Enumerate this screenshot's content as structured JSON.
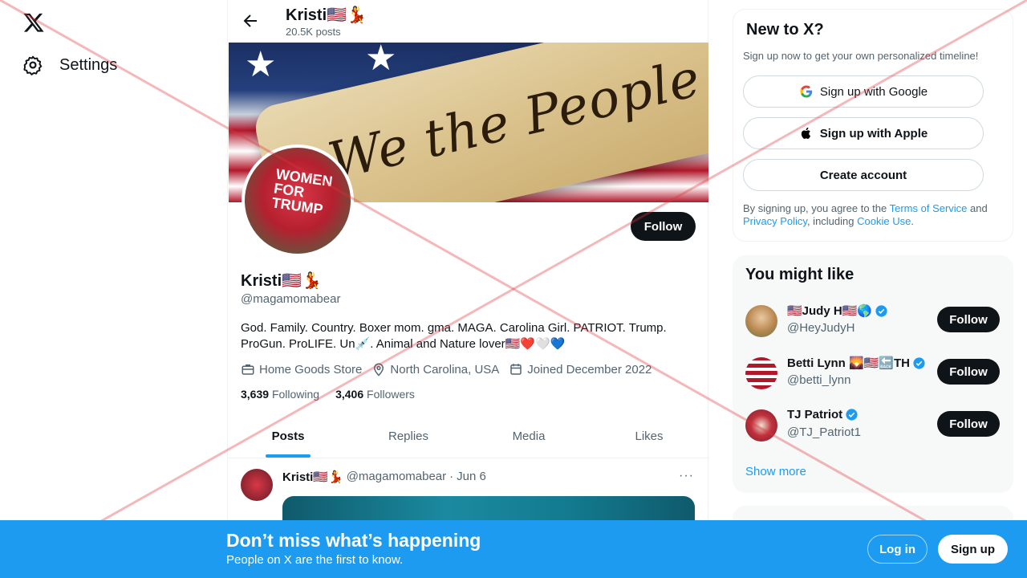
{
  "nav": {
    "logo_icon": "x-logo",
    "settings_label": "Settings"
  },
  "topbar": {
    "name": "Kristi🇺🇸💃",
    "posts_count": "20.5K posts"
  },
  "banner": {
    "script_text": "We the People"
  },
  "avatar": {
    "cap_text": "WOMEN FOR TRUMP"
  },
  "profile": {
    "follow_label": "Follow",
    "name": "Kristi🇺🇸💃",
    "handle": "@magamomabear",
    "bio": "God. Family. Country. Boxer mom. gma. MAGA. Carolina Girl. PATRIOT. Trump. ProGun. ProLIFE. Un💉. Animal and Nature lover🇺🇸❤️🤍💙",
    "work": "Home Goods Store",
    "location": "North Carolina, USA",
    "joined": "Joined December 2022",
    "following_count": "3,639",
    "following_label": "Following",
    "followers_count": "3,406",
    "followers_label": "Followers"
  },
  "tabs": [
    "Posts",
    "Replies",
    "Media",
    "Likes"
  ],
  "post": {
    "name": "Kristi🇺🇸💃",
    "handle": "@magamomabear",
    "sep": "·",
    "date": "Jun 6",
    "more": "···"
  },
  "new_to_x": {
    "title": "New to X?",
    "subtitle": "Sign up now to get your own personalized timeline!",
    "google_label": "Sign up with Google",
    "apple_label": "Sign up with Apple",
    "create_label": "Create account",
    "legal_prefix": "By signing up, you agree to the ",
    "terms": "Terms of Service",
    "and": " and ",
    "privacy": "Privacy Policy",
    "including": ", including ",
    "cookie": "Cookie Use",
    "period": "."
  },
  "you_might_like": {
    "title": "You might like",
    "users": [
      {
        "name": "🇺🇸Judy H🇺🇸🌎",
        "handle": "@HeyJudyH",
        "follow": "Follow",
        "avatar_color": "#b8864f"
      },
      {
        "name": "Betti Lynn 🌄🇺🇸🔙TH",
        "handle": "@betti_lynn",
        "follow": "Follow",
        "avatar_color": "#8c2b3a"
      },
      {
        "name": "TJ Patriot",
        "handle": "@TJ_Patriot1",
        "follow": "Follow",
        "avatar_color": "#c1313e"
      }
    ],
    "show_more": "Show more"
  },
  "bottom_bar": {
    "title": "Don’t miss what’s happening",
    "subtitle": "People on X are the first to know.",
    "login": "Log in",
    "signup": "Sign up"
  },
  "colors": {
    "accent": "#1d9bf0",
    "text_primary": "#0f1419",
    "text_secondary": "#536471",
    "overlay_red": "#e0353a"
  }
}
